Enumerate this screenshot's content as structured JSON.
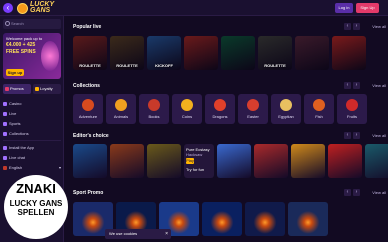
{
  "app": {
    "logo_line1": "LUCKY",
    "logo_line2": "GANS",
    "login": "Log in",
    "signup": "Sign Up",
    "back": "‹"
  },
  "sidebar": {
    "search_placeholder": "Search",
    "promo": {
      "line1": "Welcome pack up to",
      "amount": "€4.000 + 425",
      "free": "FREE SPINS",
      "button": "Sign up"
    },
    "tabs": [
      "Promos",
      "Loyalty"
    ],
    "items": [
      "Casino",
      "Live",
      "Sports",
      "Collections"
    ],
    "items2": [
      "Install the App",
      "Live chat",
      "English"
    ]
  },
  "sections": {
    "popular": {
      "title": "Popular live",
      "view_all": "View all"
    },
    "collections": {
      "title": "Collections",
      "view_all": "View all"
    },
    "editors": {
      "title": "Editor's choice",
      "view_all": "View all"
    },
    "sport": {
      "title": "Sport Promo",
      "view_all": "View all"
    }
  },
  "live_tiles": [
    {
      "label": "ROULETTE",
      "color": "#5a1a1a"
    },
    {
      "label": "ROULETTE",
      "color": "#3b2a1a"
    },
    {
      "label": "KICKOFF",
      "color": "#1a3a6a"
    },
    {
      "label": "",
      "color": "#6a1a1a"
    },
    {
      "label": "",
      "color": "#0a3a2a"
    },
    {
      "label": "ROULETTE",
      "color": "#2a2a2a"
    },
    {
      "label": "",
      "color": "#3a1a2a"
    },
    {
      "label": "",
      "color": "#7a1a1a"
    }
  ],
  "collections": [
    {
      "label": "Adventure",
      "color": "#d84b1e"
    },
    {
      "label": "Animals",
      "color": "#f0a020"
    },
    {
      "label": "Books",
      "color": "#c83a2a"
    },
    {
      "label": "Coins",
      "color": "#f2b01e"
    },
    {
      "label": "Dragons",
      "color": "#e0402a"
    },
    {
      "label": "Easter",
      "color": "#d63e2e"
    },
    {
      "label": "Egyptian",
      "color": "#e8c060"
    },
    {
      "label": "Fish",
      "color": "#e06020"
    },
    {
      "label": "Fruits",
      "color": "#d02a2a"
    }
  ],
  "editors": {
    "tiles": [
      {
        "color": "#1a4a8a"
      },
      {
        "color": "#8a3a1a"
      },
      {
        "color": "#6a5a1a"
      }
    ],
    "featured": {
      "name": "Pure Ecstasy",
      "tag": "Hacksaw",
      "button": "Play",
      "try": "Try for fun"
    },
    "tiles2": [
      {
        "color": "#3a6ad0"
      },
      {
        "color": "#aa2a2a"
      },
      {
        "color": "#d08a1a"
      },
      {
        "color": "#c02020"
      },
      {
        "color": "#1a5a6a"
      }
    ]
  },
  "sport_tiles": [
    {
      "color": "#1a2a6a"
    },
    {
      "color": "#0a1a4a"
    },
    {
      "color": "#1a3a8a"
    },
    {
      "color": "#0a2060"
    },
    {
      "color": "#101a4a"
    },
    {
      "color": "#1a2a5a"
    }
  ],
  "cookie": {
    "text": "We use cookies",
    "close": "×"
  },
  "watermark": {
    "top": "ZNAKI",
    "bottom1": "LUCKY GANS",
    "bottom2": "SPELLEN"
  }
}
